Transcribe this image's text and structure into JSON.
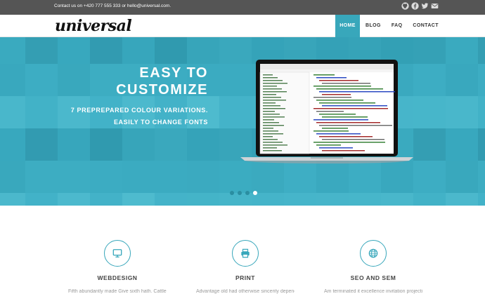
{
  "topbar": {
    "contact_text": "Contact us on +420 777 555 333 or hello@universal.com.",
    "social_icons": [
      "github-icon",
      "facebook-icon",
      "twitter-icon",
      "email-icon"
    ]
  },
  "brand": {
    "logo": "universal"
  },
  "nav": {
    "items": [
      {
        "label": "HOME",
        "active": true
      },
      {
        "label": "BLOG"
      },
      {
        "label": "FAQ"
      },
      {
        "label": "CONTACT"
      }
    ]
  },
  "hero": {
    "title_line1": "EASY TO",
    "title_line2": "CUSTOMIZE",
    "sub_line1": "7 PREPREPARED COLOUR VARIATIONS.",
    "sub_line2": "EASILY TO CHANGE FONTS",
    "slide_count": 4,
    "active_slide": 4
  },
  "services": [
    {
      "name": "WEBDESIGN",
      "icon": "monitor-icon",
      "desc": "Fifth abundantly made Give sixth hath. Cattle creature i"
    },
    {
      "name": "PRINT",
      "icon": "printer-icon",
      "desc": "Advantage old had otherwise sincerity dependent"
    },
    {
      "name": "SEO AND SEM",
      "icon": "globe-icon",
      "desc": "Am terminated it excellence invitation projection as. She"
    }
  ],
  "colors": {
    "accent": "#38a7bb",
    "hero_bg": "#3fb0c6",
    "topbar_bg": "#555555"
  }
}
